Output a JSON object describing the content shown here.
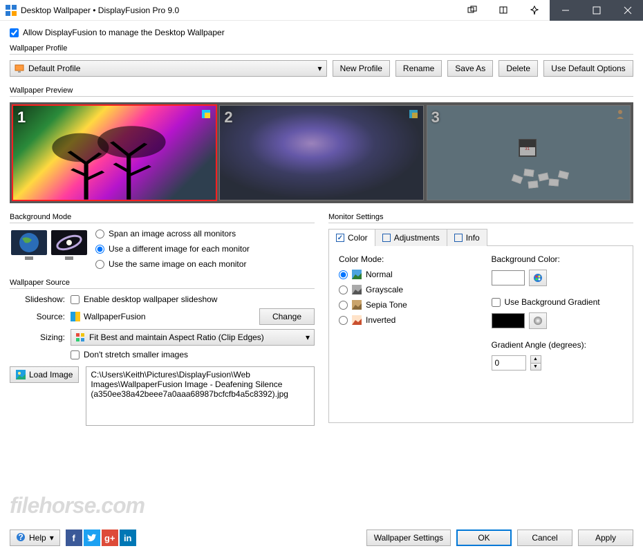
{
  "titlebar": {
    "title": "Desktop Wallpaper • DisplayFusion Pro 9.0"
  },
  "allow": {
    "label": "Allow DisplayFusion to manage the Desktop Wallpaper"
  },
  "profile": {
    "group": "Wallpaper Profile",
    "selected": "Default Profile",
    "buttons": {
      "new": "New Profile",
      "rename": "Rename",
      "saveAs": "Save As",
      "delete": "Delete",
      "defaults": "Use Default Options"
    }
  },
  "preview": {
    "group": "Wallpaper Preview",
    "monitors": [
      {
        "num": "1"
      },
      {
        "num": "2"
      },
      {
        "num": "3"
      }
    ]
  },
  "bgmode": {
    "group": "Background Mode",
    "options": {
      "span": "Span an image across all monitors",
      "diff": "Use a different image for each monitor",
      "same": "Use the same image on each monitor"
    }
  },
  "source": {
    "group": "Wallpaper Source",
    "slideshow": {
      "label": "Slideshow:",
      "enable": "Enable desktop wallpaper slideshow"
    },
    "src": {
      "label": "Source:",
      "value": "WallpaperFusion",
      "change": "Change"
    },
    "sizing": {
      "label": "Sizing:",
      "value": "Fit Best and maintain Aspect Ratio (Clip Edges)"
    },
    "dontStretch": "Don't stretch smaller images",
    "load": "Load Image",
    "path": "C:\\Users\\Keith\\Pictures\\DisplayFusion\\Web Images\\WallpaperFusion Image - Deafening Silence (a350ee38a42beee7a0aaa68987bcfcfb4a5c8392).jpg"
  },
  "monitorSettings": {
    "group": "Monitor Settings",
    "tabs": {
      "color": "Color",
      "adjustments": "Adjustments",
      "info": "Info"
    },
    "colorMode": {
      "label": "Color Mode:",
      "options": {
        "normal": "Normal",
        "grayscale": "Grayscale",
        "sepia": "Sepia Tone",
        "inverted": "Inverted"
      }
    },
    "bgColor": {
      "label": "Background Color:"
    },
    "gradient": {
      "use": "Use Background Gradient",
      "angleLabel": "Gradient Angle (degrees):",
      "angle": "0"
    }
  },
  "footer": {
    "help": "Help",
    "wallpaperSettings": "Wallpaper Settings",
    "ok": "OK",
    "cancel": "Cancel",
    "apply": "Apply"
  },
  "watermark": "filehorse.com"
}
